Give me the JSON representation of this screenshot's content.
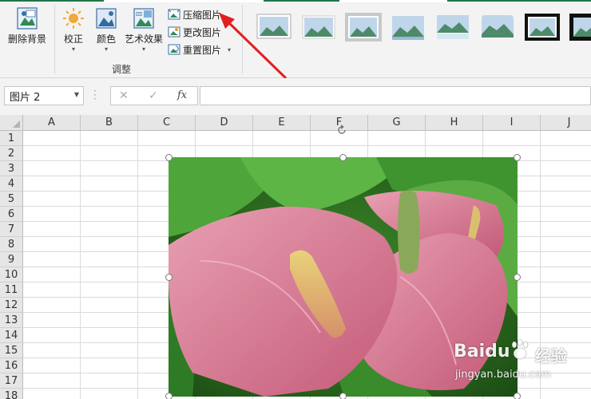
{
  "ribbon": {
    "remove_background": "删除背景",
    "corrections": "校正",
    "color": "颜色",
    "artistic_effects": "艺术效果",
    "compress_pictures": "压缩图片",
    "change_picture": "更改图片",
    "reset_picture": "重置图片",
    "group_label": "调整",
    "accent_color": "#217346",
    "arrow_color": "#e02020"
  },
  "formula_bar": {
    "name_box": "图片 2",
    "cancel": "✕",
    "enter": "✓",
    "fx": "fx",
    "formula": ""
  },
  "columns": [
    "A",
    "B",
    "C",
    "D",
    "E",
    "F",
    "G",
    "H",
    "I",
    "J"
  ],
  "rows": [
    "1",
    "2",
    "3",
    "4",
    "5",
    "6",
    "7",
    "8",
    "9",
    "10",
    "11",
    "12",
    "13",
    "14",
    "15",
    "16",
    "17",
    "18"
  ],
  "picture": {
    "subject": "pink anthurium flowers with green leaves"
  },
  "watermark": {
    "brand": "Baidu",
    "brand_cn": "经验",
    "url": "jingyan.baidu.com"
  }
}
